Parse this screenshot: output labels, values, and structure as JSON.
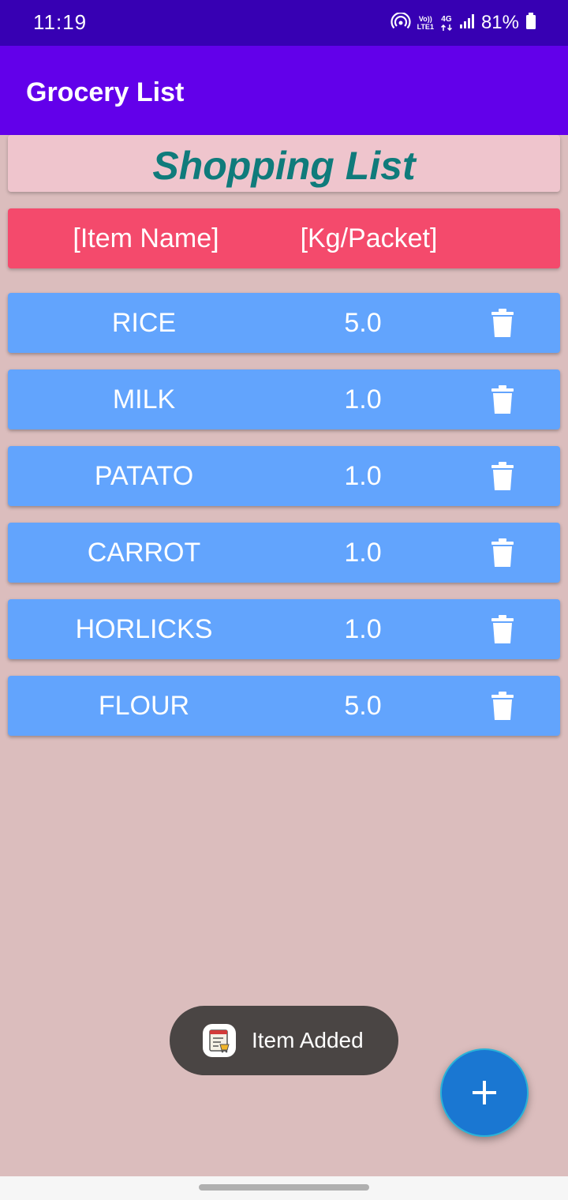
{
  "status_bar": {
    "time": "11:19",
    "lte_top": "Vo))",
    "lte_bottom": "LTE1",
    "network_type": "4G",
    "battery_percent": "81%",
    "icons": [
      "hotspot-icon",
      "volte-icon",
      "data-arrows-icon",
      "signal-icon",
      "battery-icon"
    ]
  },
  "app_bar": {
    "title": "Grocery List",
    "color": "#6200ea"
  },
  "heading": {
    "text": "Shopping List",
    "color": "#0f7b7b"
  },
  "table_header": {
    "name_label": "[Item Name]",
    "qty_label": "[Kg/Packet]",
    "color": "#f44a6c"
  },
  "items": [
    {
      "name": "RICE",
      "qty": "5.0"
    },
    {
      "name": "MILK",
      "qty": "1.0"
    },
    {
      "name": "PATATO",
      "qty": "1.0"
    },
    {
      "name": "CARROT",
      "qty": "1.0"
    },
    {
      "name": "HORLICKS",
      "qty": "1.0"
    },
    {
      "name": "FLOUR",
      "qty": "5.0"
    }
  ],
  "item_row_color": "#62a4fd",
  "delete_icon": "trash-icon",
  "toast": {
    "text": "Item Added",
    "icon": "app-icon"
  },
  "fab": {
    "icon": "plus-icon",
    "color": "#1a77d2"
  }
}
